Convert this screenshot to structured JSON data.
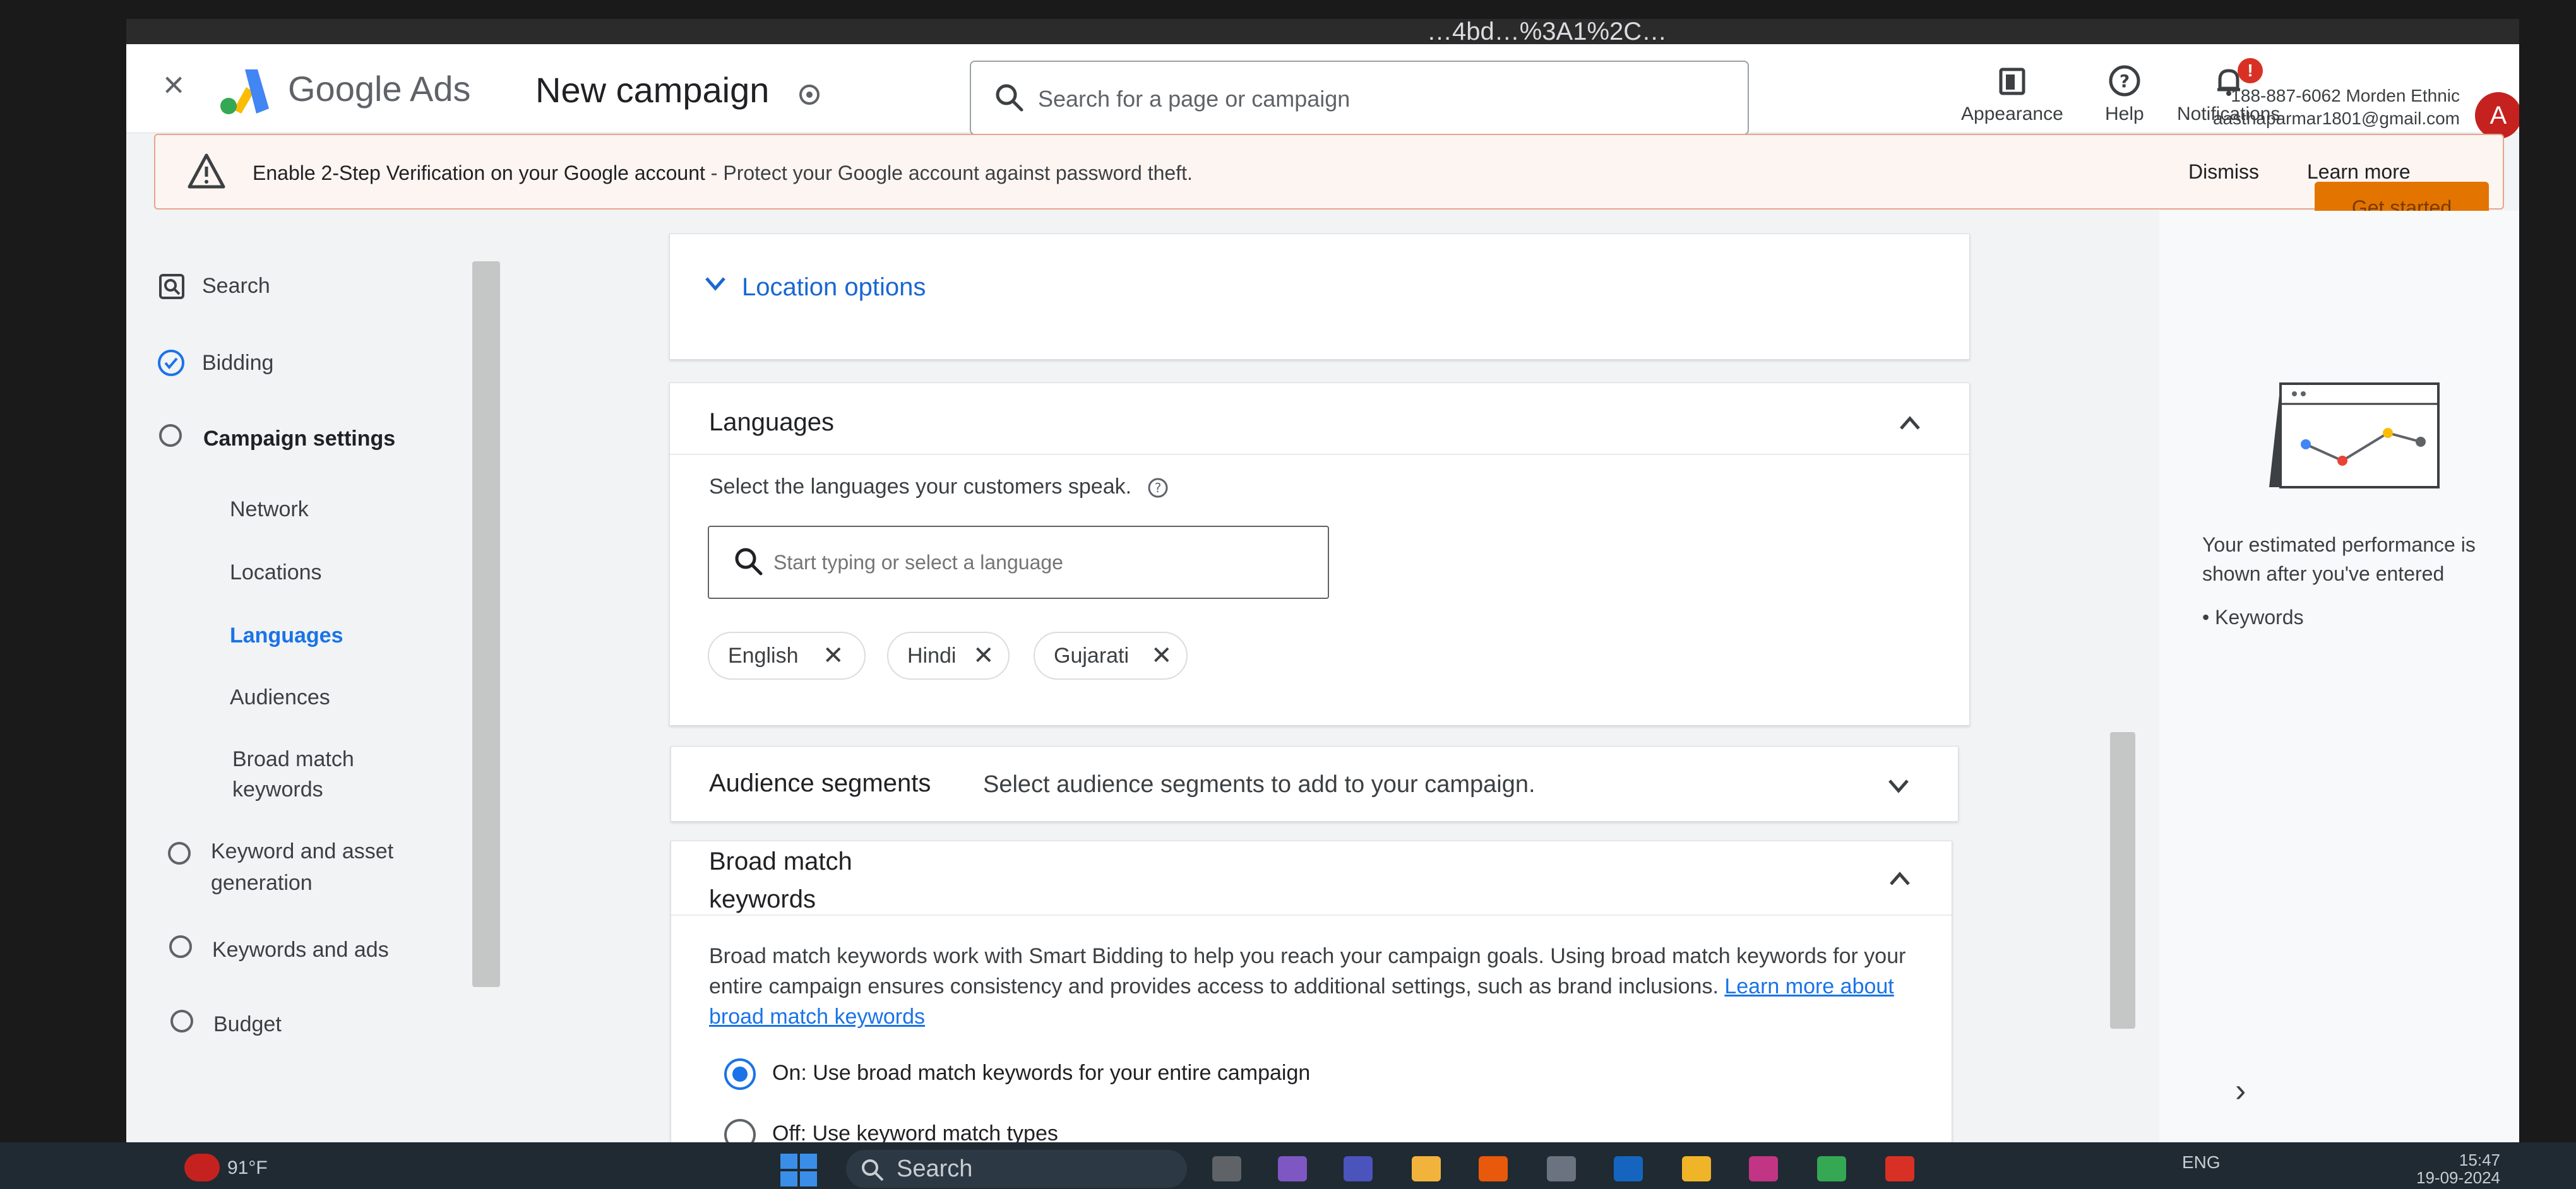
{
  "chrome": {
    "url_fragment": "…4bd…%3A1%2C…"
  },
  "header": {
    "close_label": "×",
    "brand": "Google Ads",
    "campaign_title": "New campaign",
    "search_placeholder": "Search for a page or campaign",
    "actions": [
      {
        "label": "Appearance",
        "icon": "appearance-icon"
      },
      {
        "label": "Help",
        "icon": "help-icon"
      },
      {
        "label": "Notifications",
        "icon": "bell-icon",
        "badge": "!"
      }
    ],
    "account_line1": "188-887-6062 Morden Ethnic",
    "account_line2": "aasthaparmar1801@gmail.com",
    "avatar_letter": "A"
  },
  "banner": {
    "strong_text": "Enable 2-Step Verification on your Google account",
    "rest_text": " - Protect your Google account against password theft.",
    "dismiss": "Dismiss",
    "learn_more": "Learn more",
    "get_started": "Get started"
  },
  "nav": {
    "items": [
      {
        "label": "Search"
      },
      {
        "label": "Bidding"
      },
      {
        "label": "Campaign settings"
      },
      {
        "label": "Network"
      },
      {
        "label": "Locations"
      },
      {
        "label": "Languages"
      },
      {
        "label": "Audiences"
      },
      {
        "label": "Broad match"
      },
      {
        "label": "keywords"
      },
      {
        "label": "Keyword and asset"
      },
      {
        "label": "generation"
      },
      {
        "label": "Keywords and ads"
      },
      {
        "label": "Budget"
      }
    ]
  },
  "location": {
    "options_label": "Location options"
  },
  "languages": {
    "title": "Languages",
    "prompt": "Select the languages your customers speak.",
    "input_placeholder": "Start typing or select a language",
    "chips": [
      "English",
      "Hindi",
      "Gujarati"
    ]
  },
  "audience": {
    "title": "Audience segments",
    "summary": "Select audience segments to add to your campaign."
  },
  "broad_match": {
    "title_line1": "Broad match",
    "title_line2": "keywords",
    "description": "Broad match keywords work with Smart Bidding to help you reach your campaign goals. Using broad match keywords for your entire campaign ensures consistency and provides access to additional settings, such as brand inclusions. ",
    "link": "Learn more about broad match keywords",
    "options": [
      {
        "label": "On: Use broad match keywords for your entire campaign",
        "selected": true
      },
      {
        "label": "Off: Use keyword match types",
        "selected": false
      }
    ]
  },
  "performance": {
    "text": "Your estimated performance is shown after you've entered",
    "bullet": "Keywords"
  },
  "taskbar": {
    "weather": "91°F",
    "search": "Search",
    "lang": "ENG",
    "time": "15:47",
    "date": "19-09-2024"
  },
  "colors": {
    "accent": "#1a73e8",
    "warning": "#e37400",
    "banner_border": "#e8a58b"
  }
}
